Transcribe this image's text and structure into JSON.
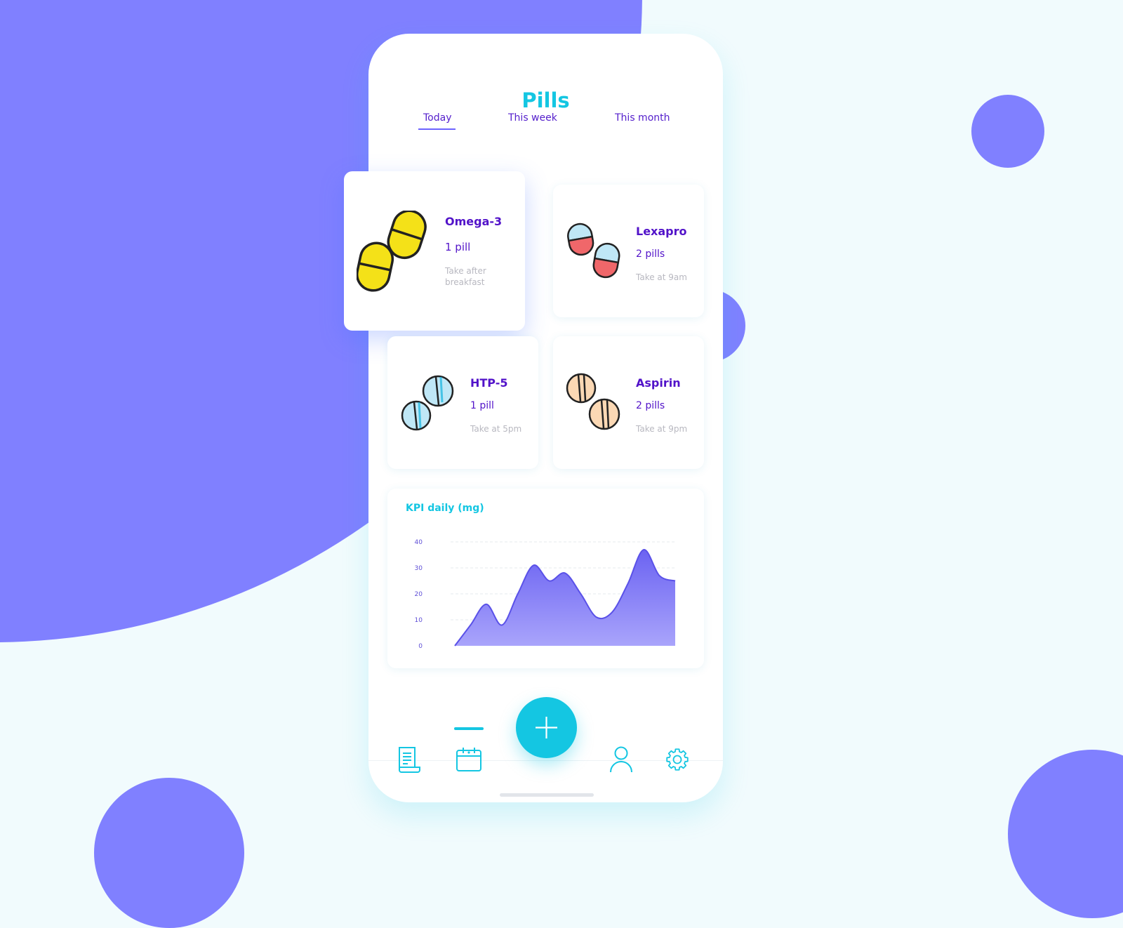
{
  "app": {
    "title": "Pills"
  },
  "tabs": [
    {
      "label": "Today",
      "active": true
    },
    {
      "label": "This week"
    },
    {
      "label": "This month"
    }
  ],
  "pills": [
    {
      "name": "Omega-3",
      "count": "1 pill",
      "note": "Take after breakfast",
      "icon": "capsule-yellow-icon",
      "active": true
    },
    {
      "name": "Lexapro",
      "count": "2 pills",
      "note": "Take at 9am",
      "icon": "capsule-blue-red-icon"
    },
    {
      "name": "HTP-5",
      "count": "1 pill",
      "note": "Take at 5pm",
      "icon": "tablet-blue-icon"
    },
    {
      "name": "Aspirin",
      "count": "2 pills",
      "note": "Take at 9pm",
      "icon": "tablet-peach-icon"
    }
  ],
  "chart_data": {
    "type": "area",
    "title": "KPI daily (mg)",
    "y_ticks": [
      "0",
      "10",
      "20",
      "30",
      "40"
    ],
    "ylim": [
      0,
      40
    ],
    "grid": true,
    "series": [
      {
        "values": [
          0,
          8,
          16,
          8,
          20,
          31,
          25,
          28,
          20,
          11,
          13,
          24,
          37,
          27,
          25
        ]
      }
    ]
  },
  "nav": {
    "items": [
      {
        "icon": "document-icon"
      },
      {
        "icon": "calendar-icon",
        "active": true
      },
      {
        "icon": "plus-icon"
      },
      {
        "icon": "user-icon"
      },
      {
        "icon": "gear-icon"
      }
    ]
  },
  "colors": {
    "background_accent": "#8080ff",
    "primary": "#14c6e2",
    "text_purple": "#5213c9",
    "note_gray": "#b8b8c0",
    "page_bg": "#f1fbfd"
  }
}
